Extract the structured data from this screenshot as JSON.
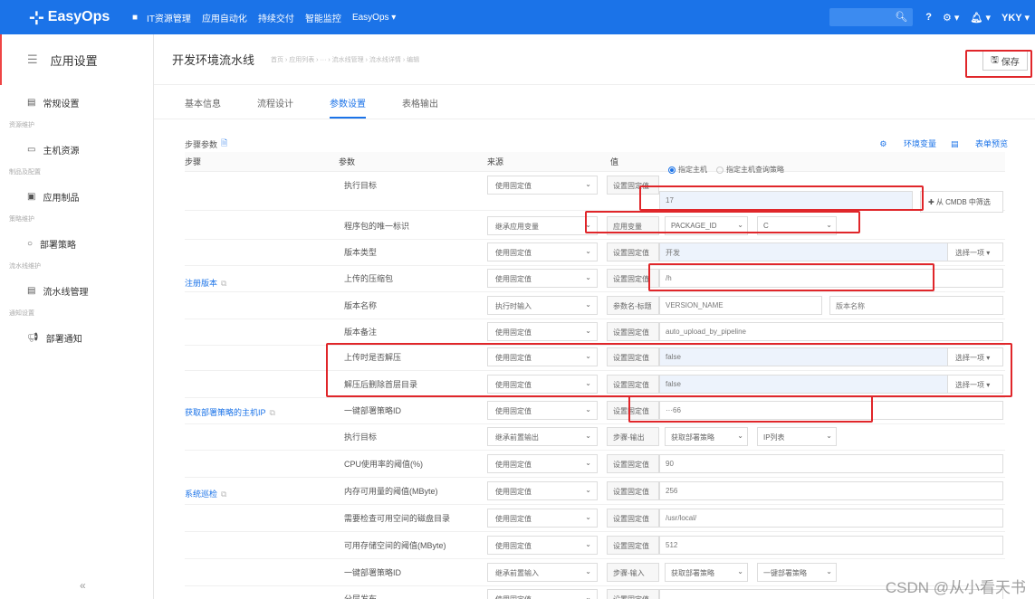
{
  "header": {
    "logo_text": "EasyOps",
    "nav": [
      "IT资源管理",
      "应用自动化",
      "持续交付",
      "智能监控",
      "EasyOps ▾"
    ],
    "user": "YKY ▾"
  },
  "sidebar": {
    "title": "应用设置",
    "items": [
      {
        "group": "",
        "label": "常规设置",
        "icon": "list-icon"
      },
      {
        "group": "资源维护",
        "label": "主机资源",
        "icon": "monitor-icon"
      },
      {
        "group": "制品及配置",
        "label": "应用制品",
        "icon": "package-icon"
      },
      {
        "group": "策略维护",
        "label": "部署策略",
        "icon": "circle-icon"
      },
      {
        "group": "流水线维护",
        "label": "流水线管理",
        "icon": "pipeline-icon"
      },
      {
        "group": "通知设置",
        "label": "部署通知",
        "icon": "megaphone-icon"
      }
    ],
    "collapse": "«"
  },
  "page": {
    "title": "开发环境流水线",
    "crumbs": "首页 › 应用列表 › ··· › 流水线管理 › 流水线详情 › 编辑",
    "save_label": "保存"
  },
  "tabs": [
    {
      "label": "基本信息",
      "active": false
    },
    {
      "label": "流程设计",
      "active": false
    },
    {
      "label": "参数设置",
      "active": true
    },
    {
      "label": "表格输出",
      "active": false
    }
  ],
  "section": {
    "title": "步骤参数",
    "env_link": "环境变量",
    "preview_link": "表单预览"
  },
  "columns": [
    "步骤",
    "参数",
    "来源",
    "值"
  ],
  "steps": [
    {
      "name": "注册版本",
      "rows_start": 0,
      "rows_end": 7
    },
    {
      "name": "获取部署策略的主机IP",
      "rows_start": 8,
      "rows_end": 8
    },
    {
      "name": "系统巡检",
      "rows_start": 9,
      "rows_end": 13
    }
  ],
  "rows": [
    {
      "param": "执行目标",
      "source": "使用固定值",
      "value_label": "设置固定值",
      "value": "17",
      "radio_on": "指定主机",
      "radio_off": "指定主机查询策略",
      "cmdb": "✚ 从 CMDB 中筛选"
    },
    {
      "param": "程序包的唯一标识",
      "source": "继承应用变量",
      "value_label": "应用变量",
      "sel1": "PACKAGE_ID",
      "sel2": "C"
    },
    {
      "param": "版本类型",
      "source": "使用固定值",
      "value_label": "设置固定值",
      "value": "开发",
      "pick": "选择一项 ▾"
    },
    {
      "param": "上传的压缩包",
      "source": "使用固定值",
      "value_label": "设置固定值",
      "value": "/h"
    },
    {
      "param": "版本名称",
      "source": "执行时输入",
      "value_label": "参数名-标题",
      "value": "VERSION_NAME",
      "value2": "版本名称"
    },
    {
      "param": "版本备注",
      "source": "使用固定值",
      "value_label": "设置固定值",
      "value": "auto_upload_by_pipeline"
    },
    {
      "param": "上传时是否解压",
      "source": "使用固定值",
      "value_label": "设置固定值",
      "value": "false",
      "pick": "选择一项 ▾"
    },
    {
      "param": "解压后删除首层目录",
      "source": "使用固定值",
      "value_label": "设置固定值",
      "value": "false",
      "pick": "选择一项 ▾"
    },
    {
      "param": "一键部署策略ID",
      "source": "使用固定值",
      "value_label": "设置固定值",
      "value": "···66"
    },
    {
      "param": "执行目标",
      "source": "继承前置输出",
      "value_label": "步骤-输出",
      "sel1": "获取部署策略",
      "sel2": "IP列表"
    },
    {
      "param": "CPU使用率的阈值(%)",
      "source": "使用固定值",
      "value_label": "设置固定值",
      "value": "90"
    },
    {
      "param": "内存可用量的阈值(MByte)",
      "source": "使用固定值",
      "value_label": "设置固定值",
      "value": "256"
    },
    {
      "param": "需要检查可用空间的磁盘目录",
      "source": "使用固定值",
      "value_label": "设置固定值",
      "value": "/usr/local/"
    },
    {
      "param": "可用存储空间的阈值(MByte)",
      "source": "使用固定值",
      "value_label": "设置固定值",
      "value": "512"
    },
    {
      "param": "一键部署策略ID",
      "source": "继承前置输入",
      "value_label": "步骤-输入",
      "sel1": "获取部署策略",
      "sel2": "一键部署策略"
    },
    {
      "param": "分层发布",
      "source": "使用固定值",
      "value_label": "设置固定值",
      "value": ""
    }
  ],
  "watermark": "CSDN @从小看天书"
}
